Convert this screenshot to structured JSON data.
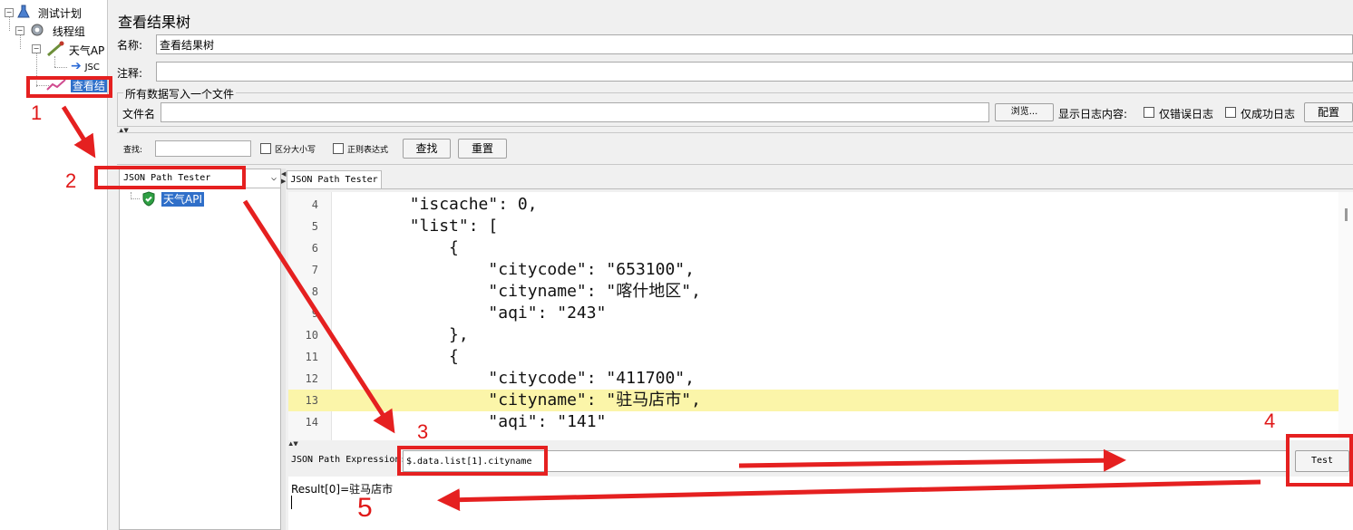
{
  "tree": {
    "test_plan": "测试计划",
    "thread_group": "线程组",
    "http_request": "天气AP",
    "extractor": "JSC",
    "result_tree": "查看结"
  },
  "panel": {
    "title": "查看结果树",
    "name_label": "名称:",
    "name_value": "查看结果树",
    "comment_label": "注释:",
    "comment_value": "",
    "file_group_title": "所有数据写入一个文件",
    "filename_label": "文件名",
    "filename_value": "",
    "browse_button": "浏览...",
    "log_label": "显示日志内容:",
    "errors_only": "仅错误日志",
    "success_only": "仅成功日志",
    "config_button": "配置"
  },
  "search": {
    "label": "查找:",
    "value": "",
    "case_sensitive": "区分大小写",
    "regex": "正则表达式",
    "find_button": "查找",
    "reset_button": "重置"
  },
  "renderer": {
    "selected": "JSON Path Tester",
    "sample": "天气API",
    "tab": "JSON Path Tester"
  },
  "code_lines": [
    {
      "num": "4",
      "text": "        \"iscache\": 0,"
    },
    {
      "num": "5",
      "text": "        \"list\": ["
    },
    {
      "num": "6",
      "text": "            {"
    },
    {
      "num": "7",
      "text": "                \"citycode\": \"653100\","
    },
    {
      "num": "8",
      "text": "                \"cityname\": \"喀什地区\","
    },
    {
      "num": "9",
      "text": "                \"aqi\": \"243\""
    },
    {
      "num": "10",
      "text": "            },"
    },
    {
      "num": "11",
      "text": "            {"
    },
    {
      "num": "12",
      "text": "                \"citycode\": \"411700\","
    },
    {
      "num": "13",
      "text": "                \"cityname\": \"驻马店市\","
    },
    {
      "num": "14",
      "text": "                \"aqi\": \"141\""
    }
  ],
  "highlighted_line": "13",
  "jsonpath": {
    "label": "JSON Path Expression:",
    "value": "$.data.list[1].cityname",
    "test_button": "Test",
    "result": "Result[0]=驻马店市"
  },
  "annotations": [
    "1",
    "2",
    "3",
    "4",
    "5"
  ],
  "colors": {
    "annotation": "#e52020",
    "selection": "#2f6fc9",
    "highlight_line": "#fbf5a9"
  }
}
